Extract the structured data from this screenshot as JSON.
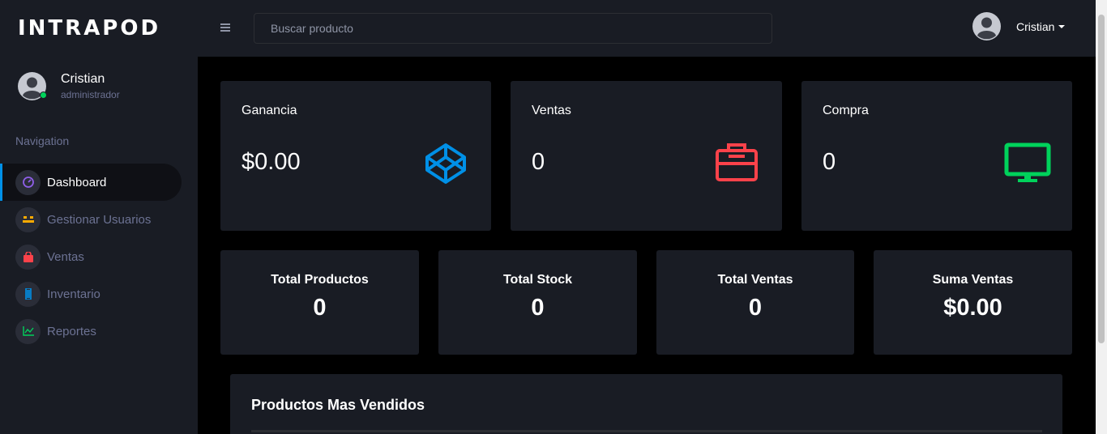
{
  "brand": "INTRAPOD",
  "search": {
    "placeholder": "Buscar producto"
  },
  "header": {
    "user_name": "Cristian"
  },
  "sidebar": {
    "profile": {
      "name": "Cristian",
      "role": "administrador"
    },
    "nav_title": "Navigation",
    "items": [
      {
        "label": "Dashboard",
        "icon": "speedometer-icon",
        "color": "#8f5fe8"
      },
      {
        "label": "Gestionar Usuarios",
        "icon": "users-icon",
        "color": "#ffab00"
      },
      {
        "label": "Ventas",
        "icon": "shopping-bag-icon",
        "color": "#fc424a"
      },
      {
        "label": "Inventario",
        "icon": "inventory-icon",
        "color": "#0090e7"
      },
      {
        "label": "Reportes",
        "icon": "chart-line-icon",
        "color": "#00d25b"
      }
    ]
  },
  "stats": [
    {
      "title": "Ganancia",
      "value": "$0.00",
      "icon": "codepen-icon",
      "color": "#0090e7"
    },
    {
      "title": "Ventas",
      "value": "0",
      "icon": "briefcase-icon",
      "color": "#fc424a"
    },
    {
      "title": "Compra",
      "value": "0",
      "icon": "monitor-icon",
      "color": "#00d25b"
    }
  ],
  "mini_stats": [
    {
      "title": "Total Productos",
      "value": "0"
    },
    {
      "title": "Total Stock",
      "value": "0"
    },
    {
      "title": "Total Ventas",
      "value": "0"
    },
    {
      "title": "Suma Ventas",
      "value": "$0.00"
    }
  ],
  "table": {
    "title": "Productos Mas Vendidos"
  }
}
